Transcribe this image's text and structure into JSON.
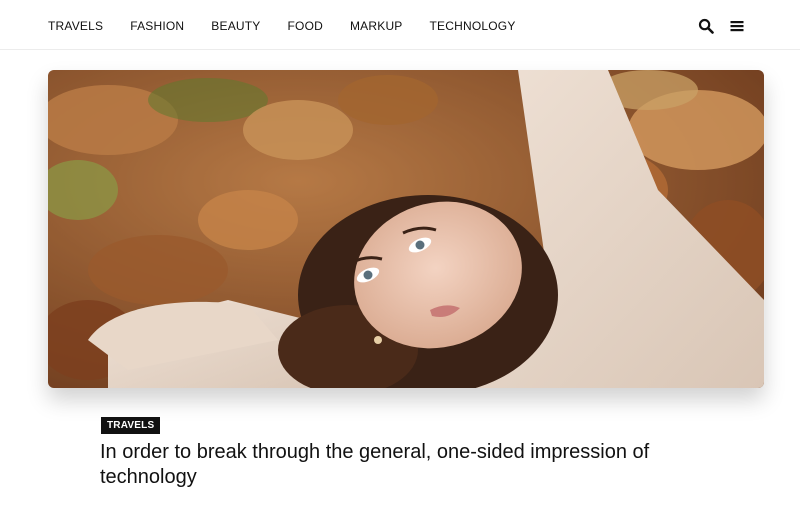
{
  "nav": {
    "items": [
      {
        "label": "TRAVELS"
      },
      {
        "label": "FASHION"
      },
      {
        "label": "BEAUTY"
      },
      {
        "label": "FOOD"
      },
      {
        "label": "MARKUP"
      },
      {
        "label": "TECHNOLOGY"
      }
    ]
  },
  "tools": {
    "search_icon": "search-icon",
    "menu_icon": "hamburger-menu-icon"
  },
  "hero": {
    "image_name": "featured-post-image"
  },
  "post": {
    "category": "TRAVELS",
    "title": "In order to break through the general, one-sided impression of technology"
  },
  "colors": {
    "badge_bg": "#111111",
    "text": "#111111",
    "divider": "#ececec"
  }
}
